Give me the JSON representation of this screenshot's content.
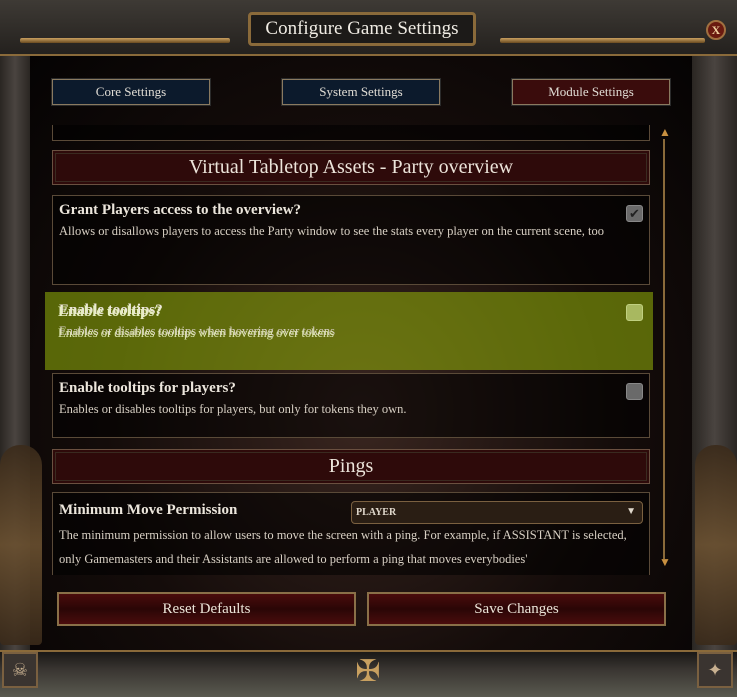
{
  "window": {
    "title": "Configure Game Settings",
    "close_label": "X"
  },
  "tabs": [
    {
      "label": "Core Settings",
      "active": false
    },
    {
      "label": "System Settings",
      "active": false
    },
    {
      "label": "Module Settings",
      "active": true
    }
  ],
  "sections": [
    {
      "title": "Virtual Tabletop Assets - Party overview",
      "settings": [
        {
          "label": "Grant Players access to the overview?",
          "hint": "Allows or disallows players to access the Party window to see the stats every player on the current scene, too",
          "checked": true
        },
        {
          "label": "Enable tooltips?",
          "hint": "Enables or disables tooltips when hovering over tokens",
          "checked": false
        },
        {
          "label": "Enable tooltips for players?",
          "hint": "Enables or disables tooltips for players, but only for tokens they own.",
          "checked": false
        }
      ]
    },
    {
      "title": "Pings",
      "settings": [
        {
          "label": "Minimum Move Permission",
          "value": "PLAYER",
          "hint": "The minimum permission to allow users to move the screen with a ping. For example, if ASSISTANT is selected, only Gamemasters and their Assistants are allowed to perform a ping that moves everybodies'"
        }
      ]
    }
  ],
  "footer": {
    "reset_label": "Reset Defaults",
    "save_label": "Save Changes"
  },
  "colors": {
    "highlight": "#96b40a",
    "tab_blue": "#0c1a2c",
    "tab_red": "#3a0c0c",
    "header_red": "#2e0a0a"
  }
}
